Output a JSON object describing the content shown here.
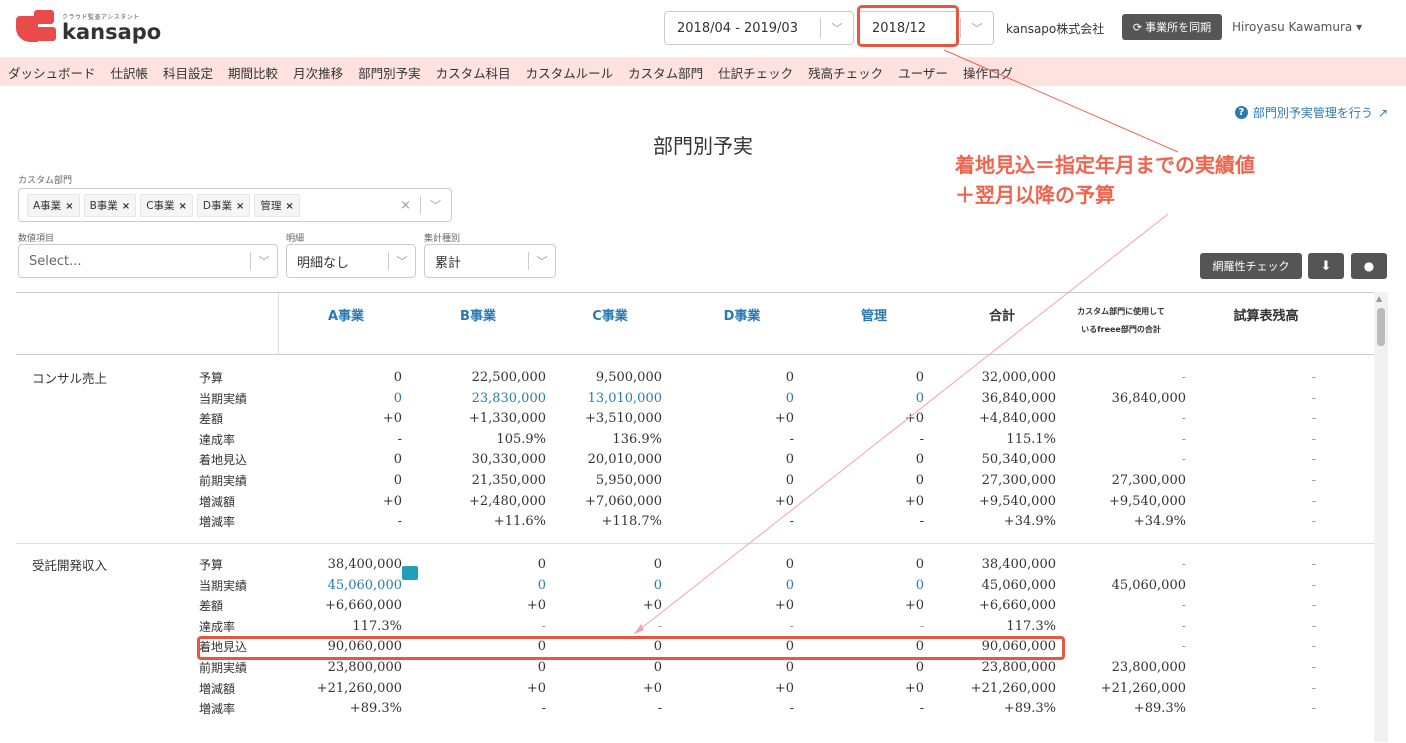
{
  "header": {
    "logo_sub": "クラウド監査アシスタント",
    "logo_text": "kansapo",
    "period": "2018/04 - 2019/03",
    "month": "2018/12",
    "company": "kansapo株式会社",
    "sync_label": "事業所を同期",
    "user": "Hiroyasu Kawamura ▾"
  },
  "nav": [
    "ダッシュボード",
    "仕訳帳",
    "科目設定",
    "期間比較",
    "月次推移",
    "部門別予実",
    "カスタム科目",
    "カスタムルール",
    "カスタム部門",
    "仕訳チェック",
    "残高チェック",
    "ユーザー",
    "操作ログ"
  ],
  "help_link": "部門別予実管理を行う",
  "page_title": "部門別予実",
  "annotation": {
    "line1": "着地見込＝指定年月までの実績値",
    "line2": "＋翌月以降の予算"
  },
  "filters": {
    "custom_dept_label": "カスタム部門",
    "tags": [
      "A事業",
      "B事業",
      "C事業",
      "D事業",
      "管理"
    ],
    "numeric_label": "数値項目",
    "numeric_placeholder": "Select...",
    "detail_label": "明細",
    "detail_value": "明細なし",
    "agg_label": "集計種別",
    "agg_value": "累計"
  },
  "buttons": {
    "check": "網羅性チェック"
  },
  "table": {
    "headers": {
      "a": "A事業",
      "b": "B事業",
      "c": "C事業",
      "d": "D事業",
      "mgmt": "管理",
      "total": "合計",
      "freee_line1": "カスタム部門に使用して",
      "freee_line2": "いるfreee部門の合計",
      "trial": "試算表残高"
    },
    "groups": [
      {
        "name": "コンサル売上",
        "rows": [
          {
            "label": "予算",
            "vals": [
              "0",
              "22,500,000",
              "9,500,000",
              "0",
              "0",
              "32,000,000",
              "-",
              "-"
            ]
          },
          {
            "label": "当期実績",
            "vals": [
              "0",
              "23,830,000",
              "13,010,000",
              "0",
              "0",
              "36,840,000",
              "36,840,000",
              "-"
            ]
          },
          {
            "label": "差額",
            "vals": [
              "+0",
              "+1,330,000",
              "+3,510,000",
              "+0",
              "+0",
              "+4,840,000",
              "-",
              "-"
            ]
          },
          {
            "label": "達成率",
            "vals": [
              "-",
              "105.9%",
              "136.9%",
              "-",
              "-",
              "115.1%",
              "-",
              "-"
            ]
          },
          {
            "label": "着地見込",
            "vals": [
              "0",
              "30,330,000",
              "20,010,000",
              "0",
              "0",
              "50,340,000",
              "-",
              "-"
            ]
          },
          {
            "label": "前期実績",
            "vals": [
              "0",
              "21,350,000",
              "5,950,000",
              "0",
              "0",
              "27,300,000",
              "27,300,000",
              "-"
            ]
          },
          {
            "label": "増減額",
            "vals": [
              "+0",
              "+2,480,000",
              "+7,060,000",
              "+0",
              "+0",
              "+9,540,000",
              "+9,540,000",
              "-"
            ]
          },
          {
            "label": "増減率",
            "vals": [
              "-",
              "+11.6%",
              "+118.7%",
              "-",
              "-",
              "+34.9%",
              "+34.9%",
              "-"
            ]
          }
        ]
      },
      {
        "name": "受託開発収入",
        "rows": [
          {
            "label": "予算",
            "vals": [
              "38,400,000",
              "0",
              "0",
              "0",
              "0",
              "38,400,000",
              "-",
              "-"
            ]
          },
          {
            "label": "当期実績",
            "vals": [
              "45,060,000",
              "0",
              "0",
              "0",
              "0",
              "45,060,000",
              "45,060,000",
              "-"
            ]
          },
          {
            "label": "差額",
            "vals": [
              "+6,660,000",
              "+0",
              "+0",
              "+0",
              "+0",
              "+6,660,000",
              "-",
              "-"
            ]
          },
          {
            "label": "達成率",
            "vals": [
              "117.3%",
              "-",
              "-",
              "-",
              "-",
              "117.3%",
              "-",
              "-"
            ]
          },
          {
            "label": "着地見込",
            "vals": [
              "90,060,000",
              "0",
              "0",
              "0",
              "0",
              "90,060,000",
              "-",
              "-"
            ]
          },
          {
            "label": "前期実績",
            "vals": [
              "23,800,000",
              "0",
              "0",
              "0",
              "0",
              "23,800,000",
              "23,800,000",
              "-"
            ]
          },
          {
            "label": "増減額",
            "vals": [
              "+21,260,000",
              "+0",
              "+0",
              "+0",
              "+0",
              "+21,260,000",
              "+21,260,000",
              "-"
            ]
          },
          {
            "label": "増減率",
            "vals": [
              "+89.3%",
              "-",
              "-",
              "-",
              "-",
              "+89.3%",
              "+89.3%",
              "-"
            ]
          }
        ]
      }
    ]
  },
  "colors": {
    "accent": "#e94b4b",
    "nav_bg": "#fde2e0",
    "link": "#2a7ab0",
    "highlight": "#e8563f"
  }
}
